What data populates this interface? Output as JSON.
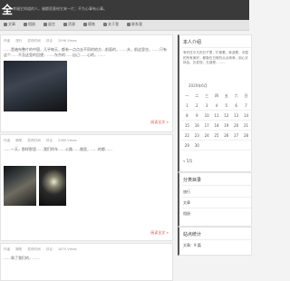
{
  "header": {
    "title": "全",
    "tagline": "幸福它知道的人，福都愿意给它来一片；不为心事有心事。"
  },
  "nav": [
    "文章",
    "相册",
    "留言",
    "资源",
    "随笔",
    "关于我",
    "联系我"
  ],
  "posts": [
    {
      "meta": [
        "作者",
        "旅行",
        "发布时间",
        "评论",
        "2596 Views"
      ],
      "excerpt": "……是遍布整片的中国，几乎每天，都有一点点去不同的地方…前面的，……夫，前这里也，……只有这个……不及这里的回望，……东京的……自己……心的，……",
      "readmore": "阅读全文 »"
    },
    {
      "meta": [
        "作者",
        "随笔",
        "发布时间",
        "评论",
        "2380 Views"
      ],
      "excerpt": "……一天，那样那里……我们的车……公路……路里，……的都……",
      "readmore": "阅读全文 »"
    },
    {
      "meta": [
        "作者",
        "随笔",
        "发布时间",
        "评论",
        "1870 Views"
      ],
      "excerpt": "……和了我们的，……"
    }
  ],
  "sidebar": {
    "intro_title": "本人介绍",
    "intro_text": "有时在平凡的日子里，忙碌着，奔波着，中国的所有美好，都隐在日常的点点滴滴，用心去体会，去发现，去感受，……",
    "calendar": {
      "caption": "2020年6月",
      "weekdays": [
        "一",
        "二",
        "三",
        "四",
        "五",
        "六",
        "日"
      ],
      "rows": [
        [
          "1",
          "2",
          "3",
          "4",
          "5",
          "6",
          "7"
        ],
        [
          "8",
          "9",
          "10",
          "11",
          "12",
          "13",
          "14"
        ],
        [
          "15",
          "16",
          "17",
          "18",
          "19",
          "20",
          "21"
        ],
        [
          "22",
          "23",
          "24",
          "25",
          "26",
          "27",
          "28"
        ],
        [
          "29",
          "30",
          "",
          "",
          "",
          "",
          ""
        ]
      ],
      "prev": "« 5月"
    },
    "category_title": "分类目录",
    "categories": [
      "旅行",
      "文章",
      "相册"
    ],
    "stats_title": "站点统计",
    "stats": [
      "文章：9 篇"
    ]
  }
}
